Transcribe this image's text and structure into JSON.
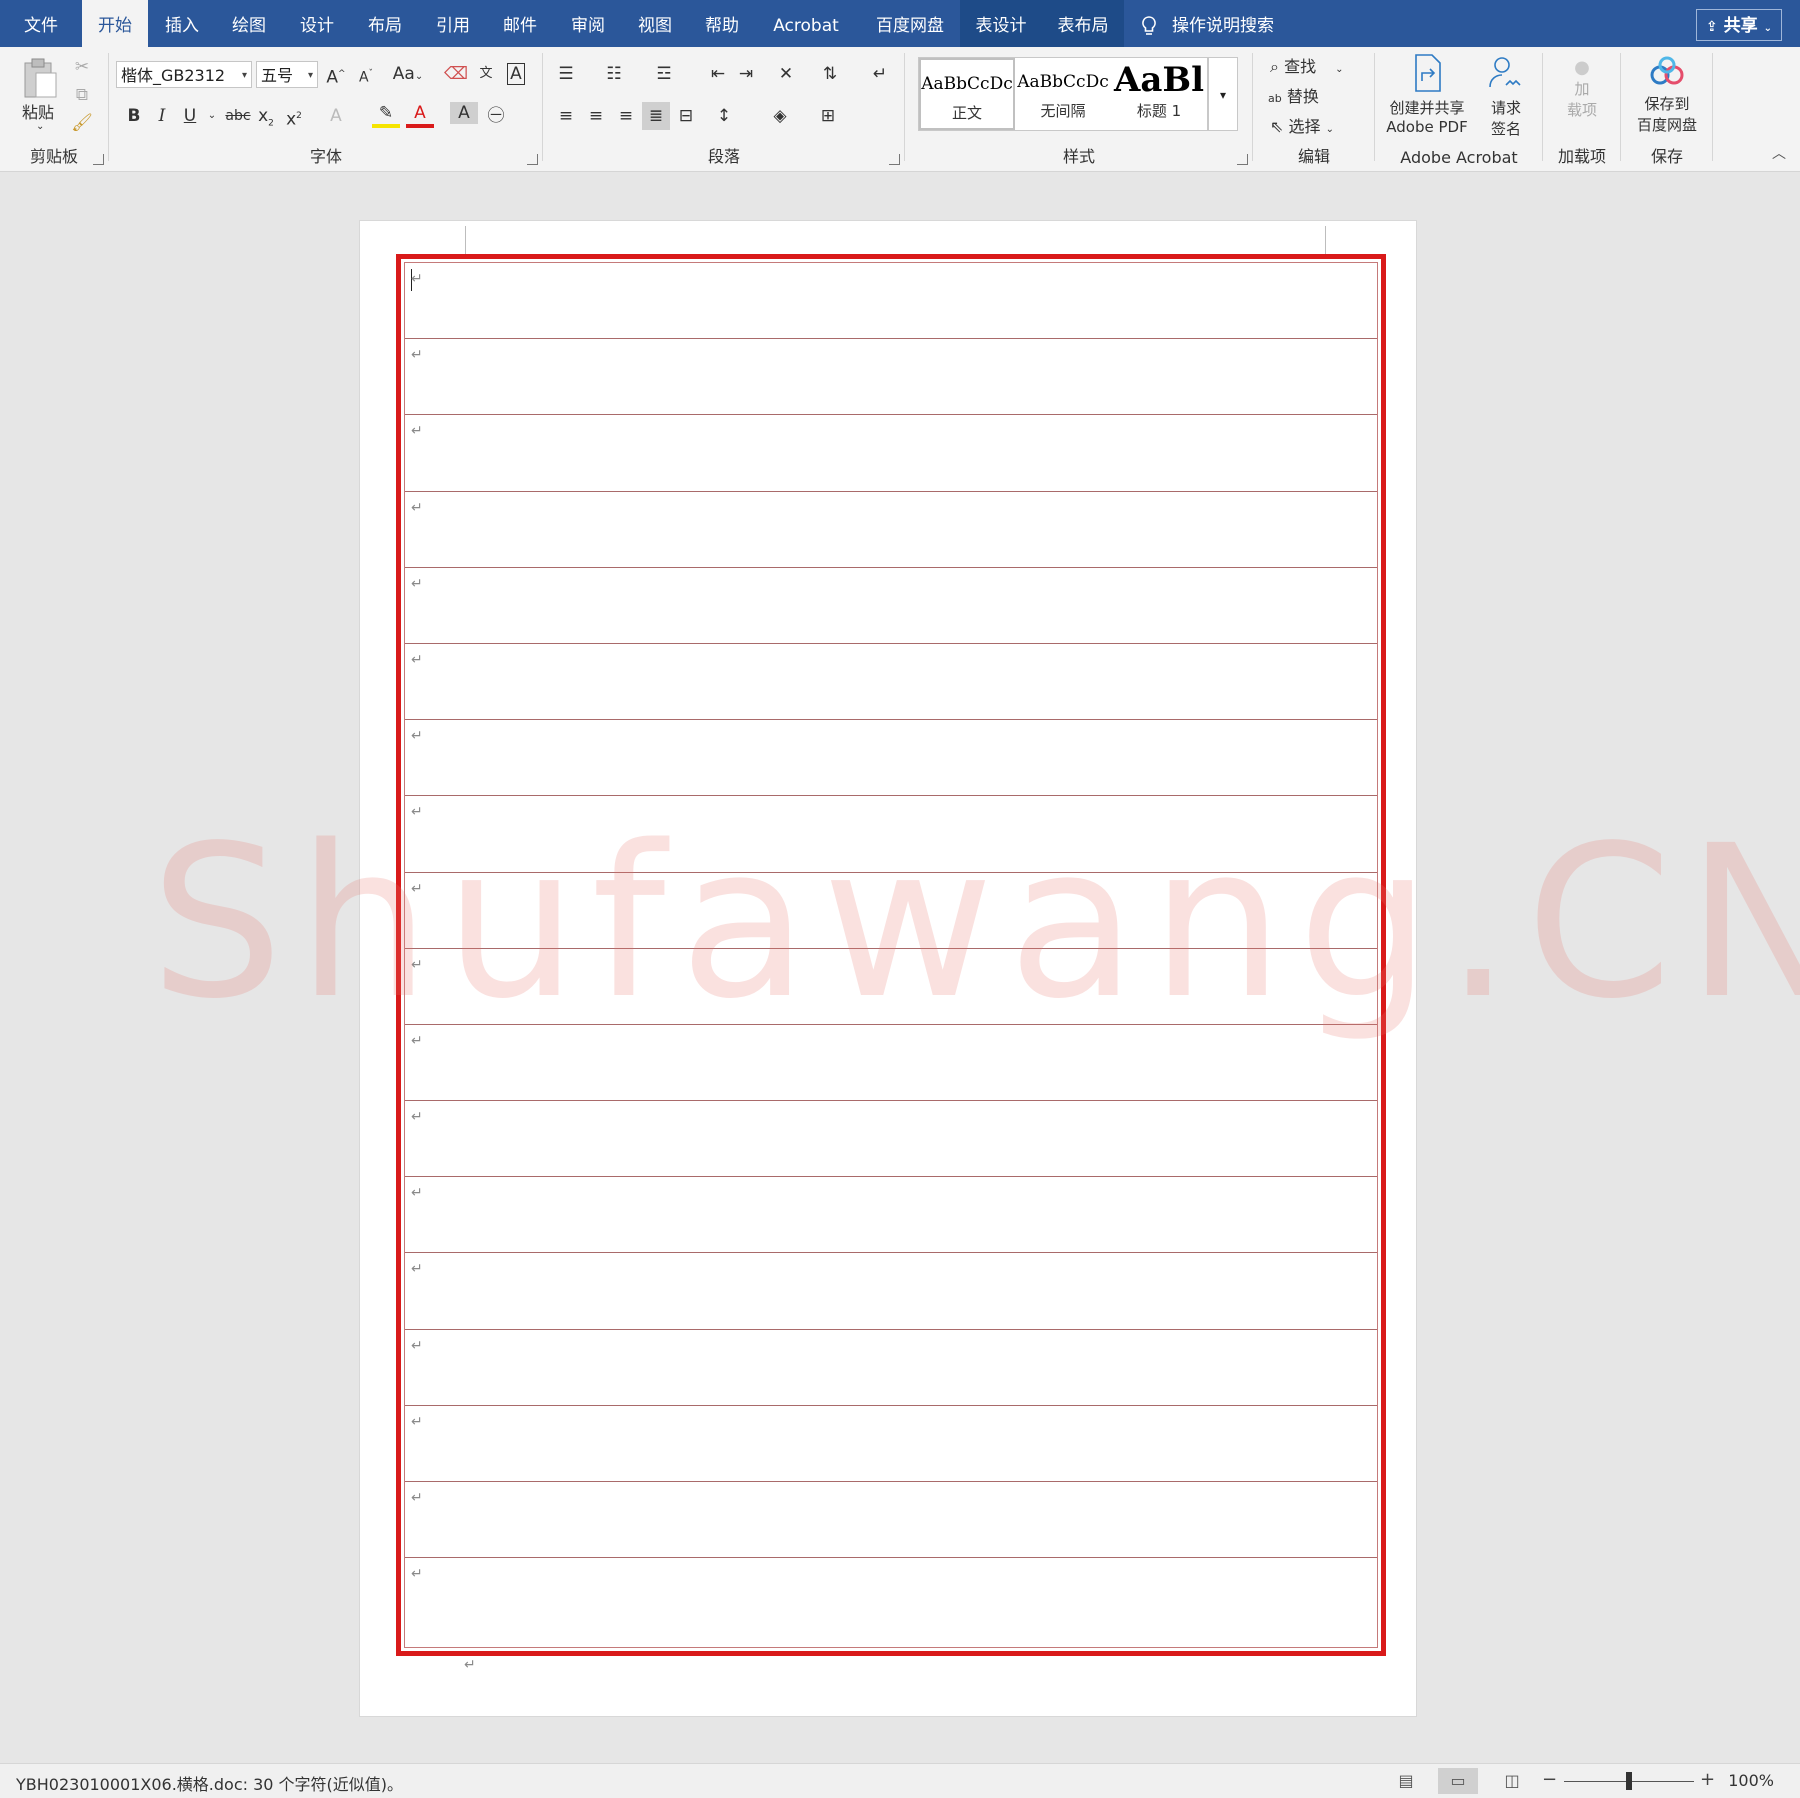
{
  "tabs": [
    "文件",
    "开始",
    "插入",
    "绘图",
    "设计",
    "布局",
    "引用",
    "邮件",
    "审阅",
    "视图",
    "帮助",
    "Acrobat",
    "百度网盘",
    "表设计",
    "表布局"
  ],
  "active_tab": "开始",
  "tellme": "操作说明搜索",
  "share": "共享",
  "ribbon": {
    "clipboard": {
      "paste": "粘贴",
      "label": "剪贴板"
    },
    "font": {
      "name": "楷体_GB2312",
      "size": "五号",
      "case": "Aa",
      "label": "字体"
    },
    "paragraph": {
      "label": "段落"
    },
    "styles": {
      "label": "样式",
      "items": [
        {
          "sample": "AaBbCcDc",
          "name": "正文"
        },
        {
          "sample": "AaBbCcDc",
          "name": "无间隔"
        },
        {
          "sample": "AaBl",
          "name": "标题 1"
        }
      ]
    },
    "editing": {
      "find": "查找",
      "replace": "替换",
      "select": "选择",
      "label": "编辑"
    },
    "acrobat": {
      "create_line1": "创建并共享",
      "create_line2": "Adobe PDF",
      "sign_line1": "请求",
      "sign_line2": "签名",
      "label": "Adobe Acrobat"
    },
    "addins": {
      "line1": "加",
      "line2": "载项",
      "label": "加载项"
    },
    "save": {
      "line1": "保存到",
      "line2": "百度网盘",
      "label": "保存"
    }
  },
  "document": {
    "rows": 18,
    "paragraph_mark": "↵",
    "watermark": "Shufawang.CN"
  },
  "status": {
    "text": "YBH023010001X06.横格.doc: 30 个字符(近似值)。",
    "zoom": "100%"
  },
  "colors": {
    "title_bar": "#2b579a",
    "border_red": "#d91a1a",
    "ruled_line": "#a96a6a"
  }
}
